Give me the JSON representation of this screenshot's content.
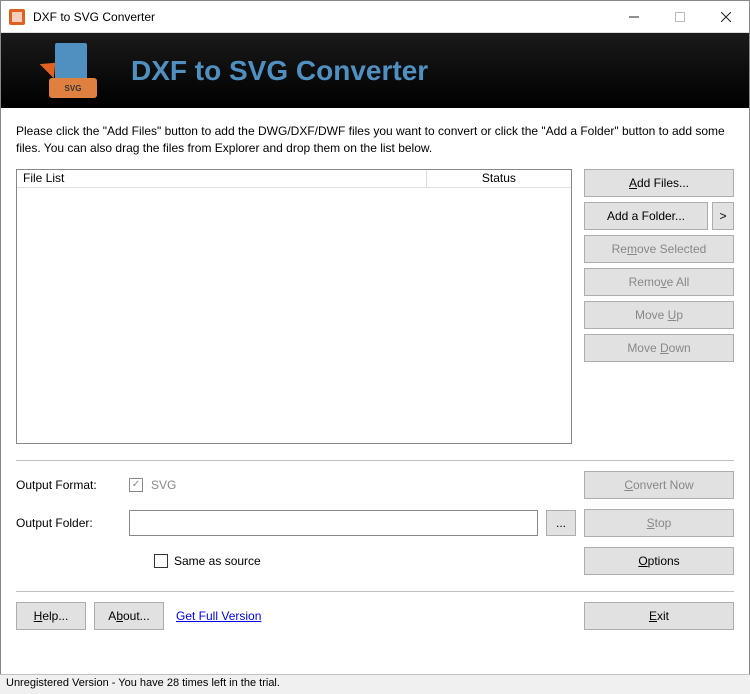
{
  "window": {
    "title": "DXF to SVG Converter"
  },
  "banner": {
    "title": "DXF to SVG Converter",
    "icon_box_text": "SVG"
  },
  "instructions": "Please click the \"Add Files\" button to add the DWG/DXF/DWF files you want to convert or click the \"Add a Folder\" button to add some files. You can also drag the files from Explorer and drop them on the list below.",
  "file_list": {
    "col_file": "File List",
    "col_status": "Status"
  },
  "buttons": {
    "add_files": "Add Files...",
    "add_folder": "Add a Folder...",
    "add_folder_caret": ">",
    "remove_selected": "Remove Selected",
    "remove_all": "Remove All",
    "move_up": "Move Up",
    "move_down": "Move Down",
    "convert_now": "Convert Now",
    "stop": "Stop",
    "options": "Options",
    "help": "Help...",
    "about": "About...",
    "exit": "Exit",
    "browse": "..."
  },
  "form": {
    "output_format_label": "Output Format:",
    "output_format_value": "SVG",
    "output_folder_label": "Output Folder:",
    "output_folder_value": "",
    "same_as_source": "Same as source"
  },
  "link": {
    "get_full": "Get Full Version"
  },
  "status": "Unregistered Version - You have 28 times left in the trial."
}
